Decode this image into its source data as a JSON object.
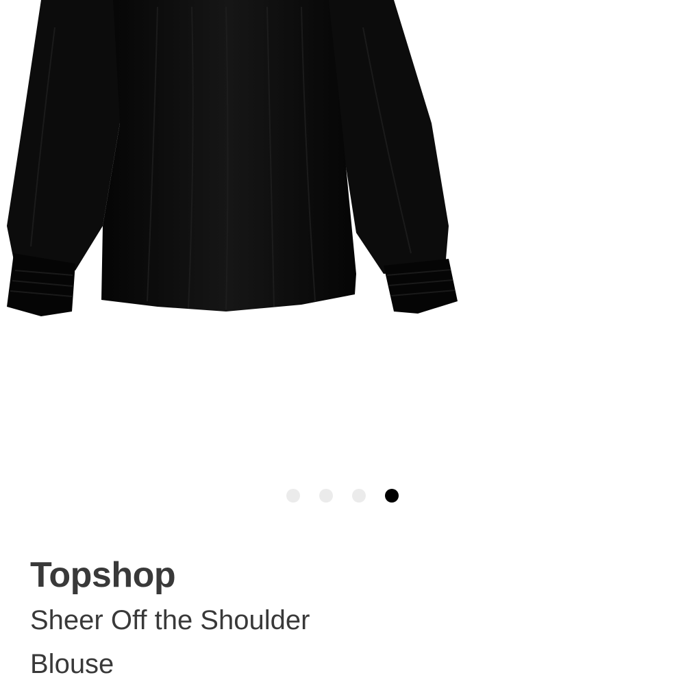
{
  "product": {
    "brand": "Topshop",
    "name": "Sheer Off the Shoulder Blouse",
    "image_alt": "black sheer off-the-shoulder blouse with smocked cuffs"
  },
  "carousel": {
    "total": 4,
    "active_index": 3
  },
  "colors": {
    "garment": "#0b0b0b",
    "text": "#393939",
    "dot_inactive": "#ebebeb",
    "dot_active": "#000000"
  }
}
